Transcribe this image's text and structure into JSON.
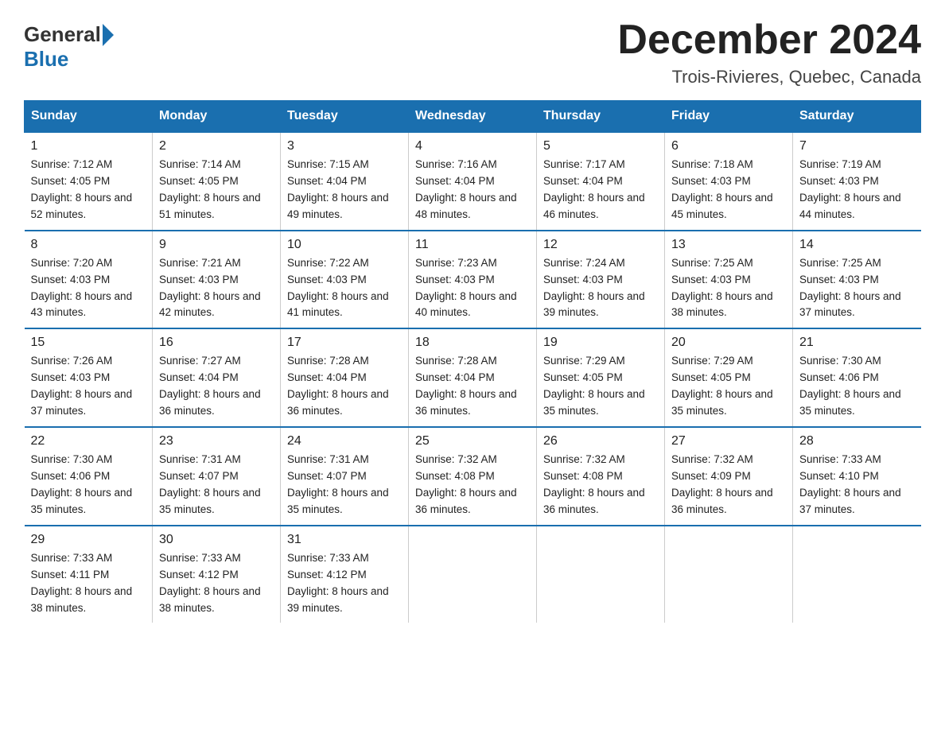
{
  "header": {
    "logo": {
      "general": "General",
      "blue": "Blue"
    },
    "title": "December 2024",
    "subtitle": "Trois-Rivieres, Quebec, Canada"
  },
  "days_of_week": [
    "Sunday",
    "Monday",
    "Tuesday",
    "Wednesday",
    "Thursday",
    "Friday",
    "Saturday"
  ],
  "weeks": [
    [
      {
        "day": "1",
        "sunrise": "7:12 AM",
        "sunset": "4:05 PM",
        "daylight": "8 hours and 52 minutes."
      },
      {
        "day": "2",
        "sunrise": "7:14 AM",
        "sunset": "4:05 PM",
        "daylight": "8 hours and 51 minutes."
      },
      {
        "day": "3",
        "sunrise": "7:15 AM",
        "sunset": "4:04 PM",
        "daylight": "8 hours and 49 minutes."
      },
      {
        "day": "4",
        "sunrise": "7:16 AM",
        "sunset": "4:04 PM",
        "daylight": "8 hours and 48 minutes."
      },
      {
        "day": "5",
        "sunrise": "7:17 AM",
        "sunset": "4:04 PM",
        "daylight": "8 hours and 46 minutes."
      },
      {
        "day": "6",
        "sunrise": "7:18 AM",
        "sunset": "4:03 PM",
        "daylight": "8 hours and 45 minutes."
      },
      {
        "day": "7",
        "sunrise": "7:19 AM",
        "sunset": "4:03 PM",
        "daylight": "8 hours and 44 minutes."
      }
    ],
    [
      {
        "day": "8",
        "sunrise": "7:20 AM",
        "sunset": "4:03 PM",
        "daylight": "8 hours and 43 minutes."
      },
      {
        "day": "9",
        "sunrise": "7:21 AM",
        "sunset": "4:03 PM",
        "daylight": "8 hours and 42 minutes."
      },
      {
        "day": "10",
        "sunrise": "7:22 AM",
        "sunset": "4:03 PM",
        "daylight": "8 hours and 41 minutes."
      },
      {
        "day": "11",
        "sunrise": "7:23 AM",
        "sunset": "4:03 PM",
        "daylight": "8 hours and 40 minutes."
      },
      {
        "day": "12",
        "sunrise": "7:24 AM",
        "sunset": "4:03 PM",
        "daylight": "8 hours and 39 minutes."
      },
      {
        "day": "13",
        "sunrise": "7:25 AM",
        "sunset": "4:03 PM",
        "daylight": "8 hours and 38 minutes."
      },
      {
        "day": "14",
        "sunrise": "7:25 AM",
        "sunset": "4:03 PM",
        "daylight": "8 hours and 37 minutes."
      }
    ],
    [
      {
        "day": "15",
        "sunrise": "7:26 AM",
        "sunset": "4:03 PM",
        "daylight": "8 hours and 37 minutes."
      },
      {
        "day": "16",
        "sunrise": "7:27 AM",
        "sunset": "4:04 PM",
        "daylight": "8 hours and 36 minutes."
      },
      {
        "day": "17",
        "sunrise": "7:28 AM",
        "sunset": "4:04 PM",
        "daylight": "8 hours and 36 minutes."
      },
      {
        "day": "18",
        "sunrise": "7:28 AM",
        "sunset": "4:04 PM",
        "daylight": "8 hours and 36 minutes."
      },
      {
        "day": "19",
        "sunrise": "7:29 AM",
        "sunset": "4:05 PM",
        "daylight": "8 hours and 35 minutes."
      },
      {
        "day": "20",
        "sunrise": "7:29 AM",
        "sunset": "4:05 PM",
        "daylight": "8 hours and 35 minutes."
      },
      {
        "day": "21",
        "sunrise": "7:30 AM",
        "sunset": "4:06 PM",
        "daylight": "8 hours and 35 minutes."
      }
    ],
    [
      {
        "day": "22",
        "sunrise": "7:30 AM",
        "sunset": "4:06 PM",
        "daylight": "8 hours and 35 minutes."
      },
      {
        "day": "23",
        "sunrise": "7:31 AM",
        "sunset": "4:07 PM",
        "daylight": "8 hours and 35 minutes."
      },
      {
        "day": "24",
        "sunrise": "7:31 AM",
        "sunset": "4:07 PM",
        "daylight": "8 hours and 35 minutes."
      },
      {
        "day": "25",
        "sunrise": "7:32 AM",
        "sunset": "4:08 PM",
        "daylight": "8 hours and 36 minutes."
      },
      {
        "day": "26",
        "sunrise": "7:32 AM",
        "sunset": "4:08 PM",
        "daylight": "8 hours and 36 minutes."
      },
      {
        "day": "27",
        "sunrise": "7:32 AM",
        "sunset": "4:09 PM",
        "daylight": "8 hours and 36 minutes."
      },
      {
        "day": "28",
        "sunrise": "7:33 AM",
        "sunset": "4:10 PM",
        "daylight": "8 hours and 37 minutes."
      }
    ],
    [
      {
        "day": "29",
        "sunrise": "7:33 AM",
        "sunset": "4:11 PM",
        "daylight": "8 hours and 38 minutes."
      },
      {
        "day": "30",
        "sunrise": "7:33 AM",
        "sunset": "4:12 PM",
        "daylight": "8 hours and 38 minutes."
      },
      {
        "day": "31",
        "sunrise": "7:33 AM",
        "sunset": "4:12 PM",
        "daylight": "8 hours and 39 minutes."
      },
      null,
      null,
      null,
      null
    ]
  ]
}
